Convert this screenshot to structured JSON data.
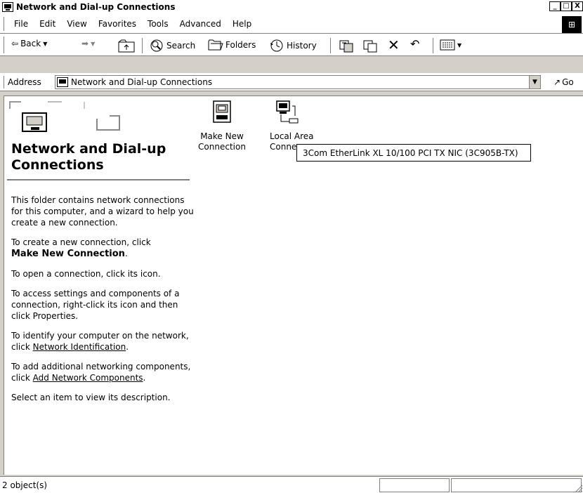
{
  "window": {
    "title": "Network and Dial-up Connections",
    "controls": [
      "_",
      "□",
      "X"
    ]
  },
  "menubar": {
    "items": [
      "File",
      "Edit",
      "View",
      "Favorites",
      "Tools",
      "Advanced",
      "Help"
    ]
  },
  "toolbar": {
    "back_label": "Back",
    "search_label": "Search",
    "folders_label": "Folders",
    "history_label": "History"
  },
  "address": {
    "label": "Address",
    "value": "Network and Dial-up Connections",
    "go_label": "Go"
  },
  "leftpane": {
    "title": "Network and Dial-up Connections",
    "p1": "This folder contains network connections for this computer, and a wizard to help you create a new connection.",
    "p2_prefix": "To create a new connection, click",
    "p2_bold": "Make New Connection",
    "p2_suffix": ".",
    "p3": "To open a connection, click its icon.",
    "p4": "To access settings and components of a connection, right-click its icon and then click Properties.",
    "p5_prefix": "To identify your computer on the network, click",
    "p5_link": "Network Identification",
    "p5_suffix": ".",
    "p6_prefix": "To add additional networking components, click",
    "p6_link": "Add Network Components",
    "p6_suffix": ".",
    "p7": "Select an item to view its description."
  },
  "items": {
    "make_new_line1": "Make New",
    "make_new_line2": "Connection",
    "lan_line1": "Local Area",
    "lan_line2": "Conne"
  },
  "tooltip": {
    "text": "3Com EtherLink XL 10/100 PCI TX NIC (3C905B-TX)"
  },
  "status": {
    "text": "2 object(s)"
  }
}
